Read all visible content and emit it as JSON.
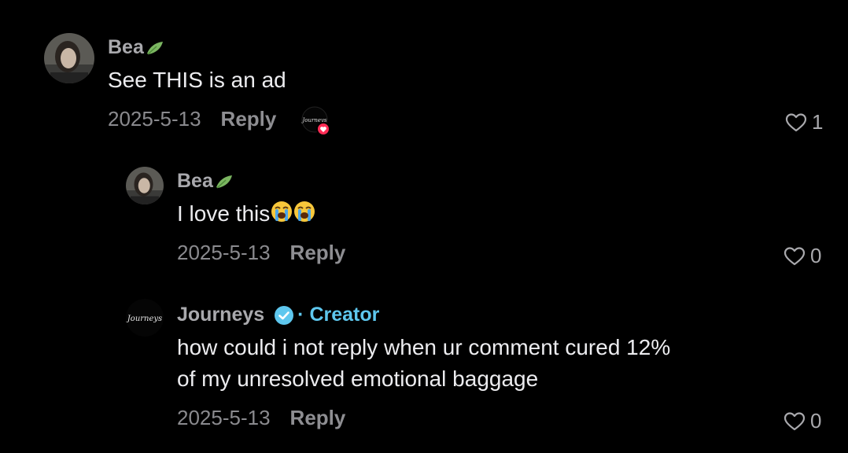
{
  "comments": [
    {
      "username": "Bea",
      "username_icon": "leaf-icon",
      "text": "See THIS is an ad",
      "date": "2025-5-13",
      "reply_label": "Reply",
      "likes": "1",
      "creator_liked": true
    },
    {
      "username": "Bea",
      "username_icon": "leaf-icon",
      "text": "I love this",
      "emojis": [
        "loudly-crying-face-icon",
        "loudly-crying-face-icon"
      ],
      "date": "2025-5-13",
      "reply_label": "Reply",
      "likes": "0"
    },
    {
      "username": "Journeys",
      "verified": true,
      "badge": "· Creator",
      "text_line1": "how could i not reply when ur comment cured 12%",
      "text_line2": "of my unresolved emotional baggage",
      "date": "2025-5-13",
      "reply_label": "Reply",
      "likes": "0"
    }
  ],
  "colors": {
    "background": "#000000",
    "username": "#a9a9ad",
    "text": "#ececef",
    "meta": "#8a8a8e",
    "creator_badge": "#5ec7ee",
    "heart_badge": "#fe2c55"
  }
}
